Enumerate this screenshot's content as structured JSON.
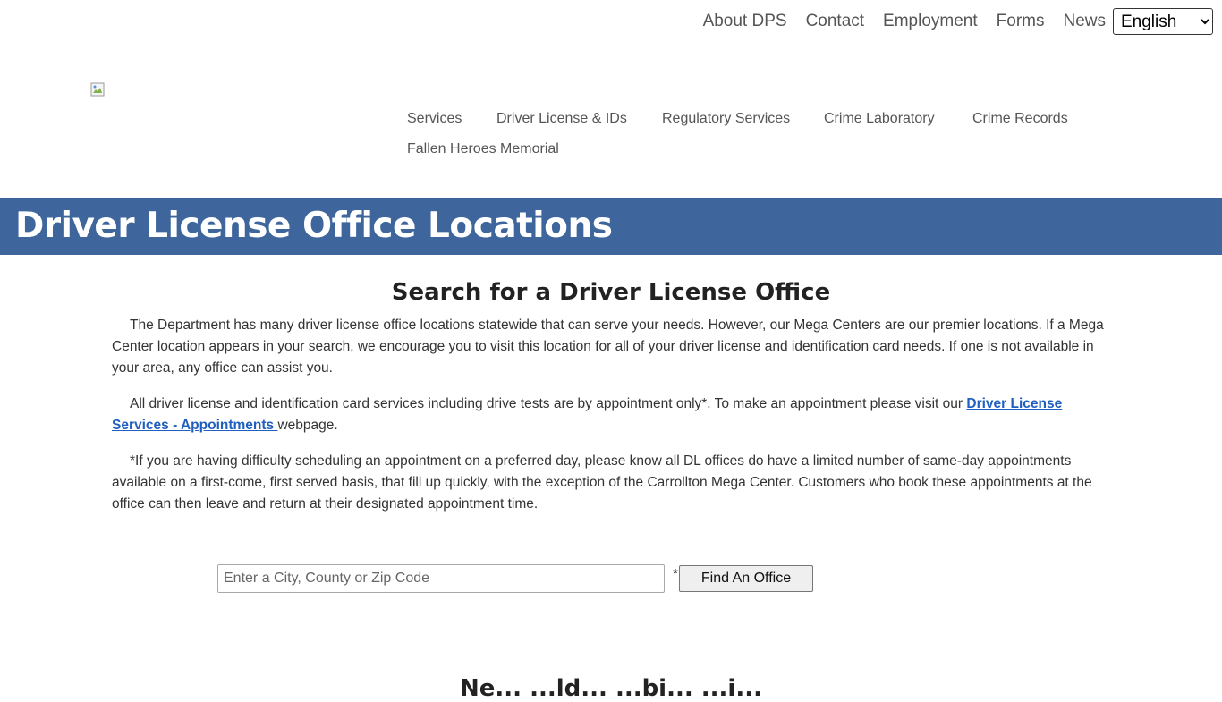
{
  "top_links": [
    "About DPS",
    "Contact",
    "Employment",
    "Forms",
    "News"
  ],
  "language": {
    "selected": "English",
    "options": [
      "English"
    ]
  },
  "main_nav": [
    "Services",
    "Driver License & IDs",
    "Regulatory Services",
    "Crime Laboratory",
    "Crime Records",
    "Fallen Heroes Memorial"
  ],
  "banner": {
    "title": "Driver License Office Locations",
    "color": "#3e669d"
  },
  "content": {
    "heading": "Search for a Driver License Office",
    "para1": "The Department has many driver license office locations statewide that can serve your needs. However, our Mega Centers are our premier locations. If a Mega Center location appears in your search, we encourage you to visit this location for all of your driver license and identification card needs. If one is not available in your area, any office can assist you.",
    "para2_before": "All driver license and identification card services including drive tests are by appointment only*. To make an appointment please visit our ",
    "para2_link": "Driver License Services - Appointments ",
    "para2_after": "webpage.",
    "para3": "*If you are having difficulty scheduling an appointment on a preferred day, please know all DL offices do have a limited number of same-day appointments available on a first-come, first served basis, that fill up quickly, with the exception of the Carrollton Mega Center. Customers who book these appointments at the office can then leave and return at their designated appointment time."
  },
  "search": {
    "placeholder": "Enter a City, County or Zip Code",
    "value": "",
    "required_marker": "*",
    "button_label": "Find An Office"
  },
  "next_heading": "Ne... ...ld... ...bi... ...i..."
}
